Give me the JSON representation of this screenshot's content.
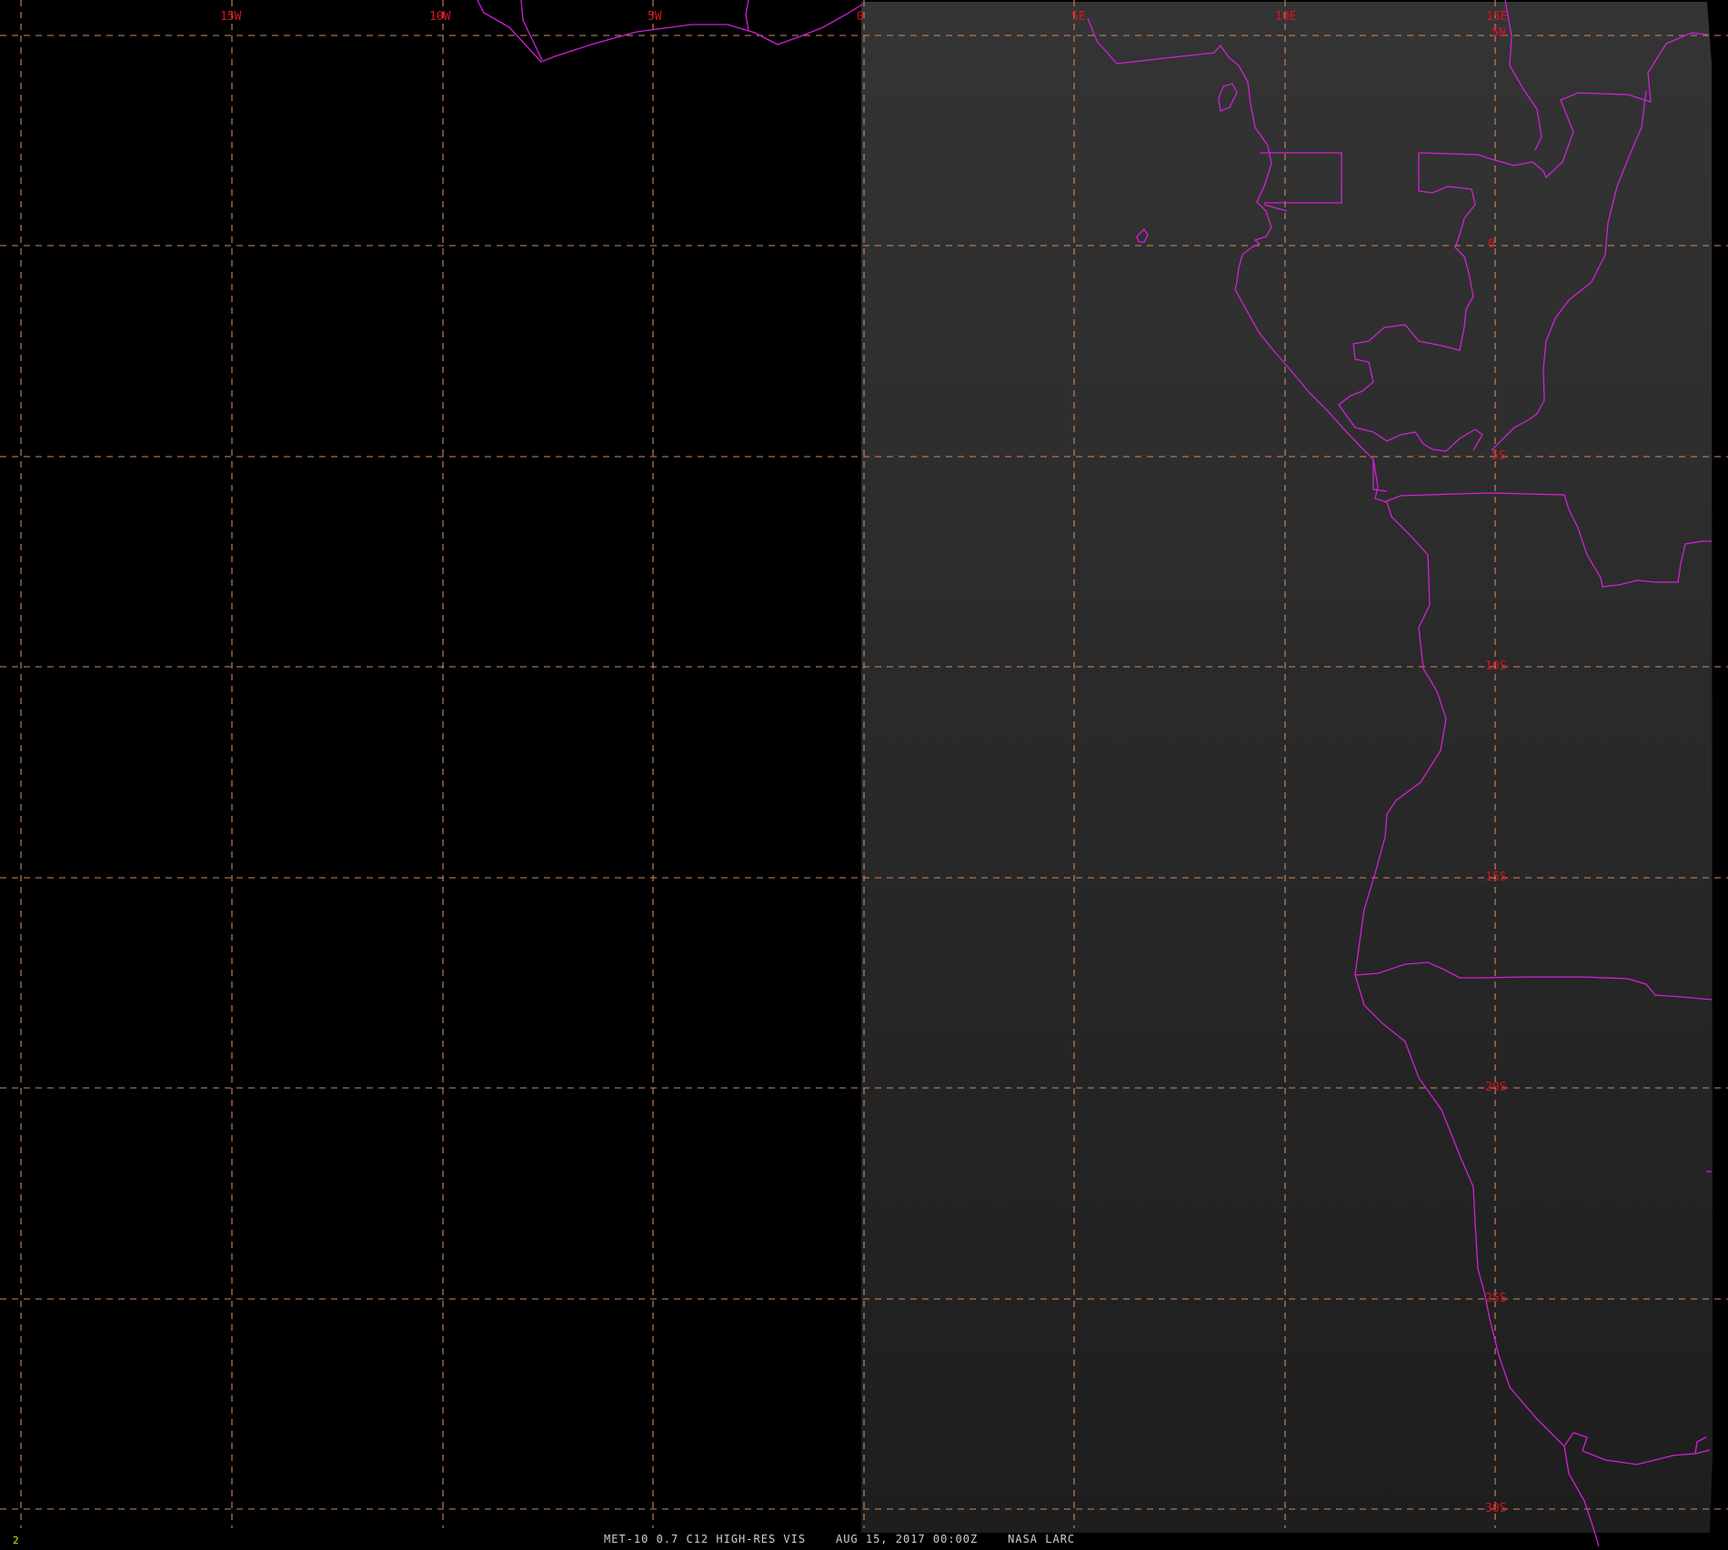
{
  "image": {
    "caption": "MET-10 0.7 C12 HIGH-RES VIS    AUG 15, 2017 00:00Z    NASA LARC",
    "frame_number": "2",
    "colors": {
      "background": "#000000",
      "satellite_swath": "#2a2a2a",
      "grid": "#d08a5e",
      "borders": "#d021d6",
      "grid_labels": "#d8141e",
      "footer_text": "#cfcfcf",
      "frame_number": "#e6e600"
    }
  },
  "map": {
    "longitude_labels": [
      "15W",
      "10W",
      "5W",
      "0",
      "5E",
      "10E",
      "15E"
    ],
    "latitude_labels": [
      "5N",
      "0",
      "5S",
      "10S",
      "15S",
      "20S",
      "25S",
      "30S"
    ]
  }
}
